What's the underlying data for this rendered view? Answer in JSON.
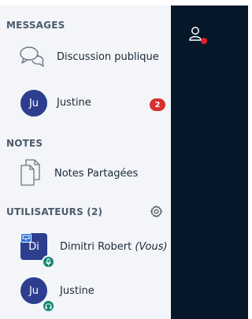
{
  "sidebar": {
    "messages": {
      "heading": "MESSAGES",
      "public_chat": {
        "label": "Discussion publique",
        "icon": "chat-bubbles-icon"
      },
      "private_chat": {
        "avatar_initials": "Ju",
        "name": "Justine",
        "unread_count": "2"
      }
    },
    "notes": {
      "heading": "NOTES",
      "shared_notes": {
        "label": "Notes Partagées",
        "icon": "documents-icon"
      }
    },
    "users": {
      "heading": "UTILISATEURS (2)",
      "settings_icon": "gear-icon",
      "list": [
        {
          "avatar_initials": "Di",
          "name": "Dimitri Robert",
          "suffix": "(Vous)",
          "status_icon": "microphone-icon",
          "role_icon": "presenter-icon"
        },
        {
          "avatar_initials": "Ju",
          "name": "Justine",
          "status_icon": "headphones-icon"
        }
      ]
    }
  },
  "right_panel": {
    "icon": "user-notification-icon"
  },
  "colors": {
    "sidebar_bg": "#f3f5f8",
    "dark_panel": "#06172a",
    "avatar": "#2d3e8e",
    "badge": "#d7302f",
    "status": "#138675"
  }
}
